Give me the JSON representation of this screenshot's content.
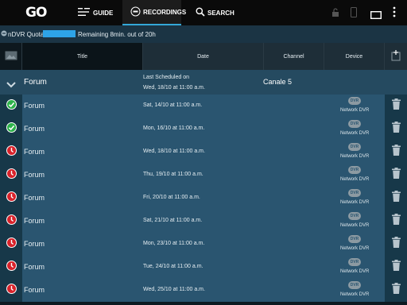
{
  "topbar": {
    "logo": "GO",
    "nav": {
      "guide": "GUIDE",
      "recordings": "RECORDINGS",
      "search": "SEARCH"
    }
  },
  "quota": {
    "label": "nDVR Quota:",
    "remaining_text": "Remaining 8min. out of 20h",
    "used_fraction": 0.6,
    "fill_color": "#2ea4e8"
  },
  "table": {
    "headers": {
      "title": "Title",
      "date": "Date",
      "channel": "Channel",
      "device": "Device"
    }
  },
  "group": {
    "title": "Forum",
    "scheduled_label": "Last Scheduled on",
    "scheduled_date": "Wed, 18/10 at 11:00 a.m.",
    "channel": "Canale 5"
  },
  "rows": [
    {
      "status": "recorded",
      "title": "Forum",
      "date": "Sat, 14/10 at 11:00 a.m.",
      "device_badge": "DVR",
      "device": "Network DVR"
    },
    {
      "status": "recorded",
      "title": "Forum",
      "date": "Mon, 16/10 at 11:00 a.m.",
      "device_badge": "DVR",
      "device": "Network DVR"
    },
    {
      "status": "scheduled",
      "title": "Forum",
      "date": "Wed, 18/10 at 11:00 a.m.",
      "device_badge": "DVR",
      "device": "Network DVR"
    },
    {
      "status": "scheduled",
      "title": "Forum",
      "date": "Thu, 19/10 at 11:00 a.m.",
      "device_badge": "DVR",
      "device": "Network DVR"
    },
    {
      "status": "scheduled",
      "title": "Forum",
      "date": "Fri, 20/10 at 11:00 a.m.",
      "device_badge": "DVR",
      "device": "Network DVR"
    },
    {
      "status": "scheduled",
      "title": "Forum",
      "date": "Sat, 21/10 at 11:00 a.m.",
      "device_badge": "DVR",
      "device": "Network DVR"
    },
    {
      "status": "scheduled",
      "title": "Forum",
      "date": "Mon, 23/10 at 11:00 a.m.",
      "device_badge": "DVR",
      "device": "Network DVR"
    },
    {
      "status": "scheduled",
      "title": "Forum",
      "date": "Tue, 24/10 at 11:00 a.m.",
      "device_badge": "DVR",
      "device": "Network DVR"
    },
    {
      "status": "scheduled",
      "title": "Forum",
      "date": "Wed, 25/10 at 11:00 a.m.",
      "device_badge": "DVR",
      "device": "Network DVR"
    }
  ],
  "colors": {
    "recorded": "#2db24a",
    "scheduled": "#d8222a",
    "accent": "#34a8d8"
  }
}
